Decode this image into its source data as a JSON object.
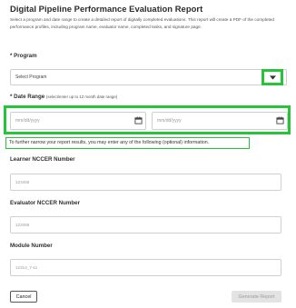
{
  "header": {
    "title": "Digital Pipeline Performance Evaluation Report",
    "description": "Select a program and date range to create a detailed report of digitally completed evaluations. This report will create a PDF of the completed performance profiles, including program name, evaluator name, completed tasks, and signature page."
  },
  "program": {
    "label": "* Program",
    "selected": "Select Program",
    "dropdown_icon": "chevron-down-icon"
  },
  "date_range": {
    "label": "* Date Range",
    "note": "(select/enter up to 12 month date range)",
    "start_placeholder": "mm/dd/yyyy",
    "end_placeholder": "mm/dd/yyyy",
    "calendar_icon": "calendar-icon"
  },
  "hint": "To further narrow your report results, you may enter any of the following (optional) information.",
  "learner": {
    "label": "Learner NCCER Number",
    "placeholder": "123456"
  },
  "evaluator": {
    "label": "Evaluator NCCER Number",
    "placeholder": "123456"
  },
  "module": {
    "label": "Module Number",
    "placeholder": "12314_7-11"
  },
  "actions": {
    "cancel": "Cancel",
    "generate": "Generate Report"
  },
  "colors": {
    "highlight": "#27c43a",
    "border": "#cfcfcf",
    "disabled_bg": "#e3e3e3"
  }
}
